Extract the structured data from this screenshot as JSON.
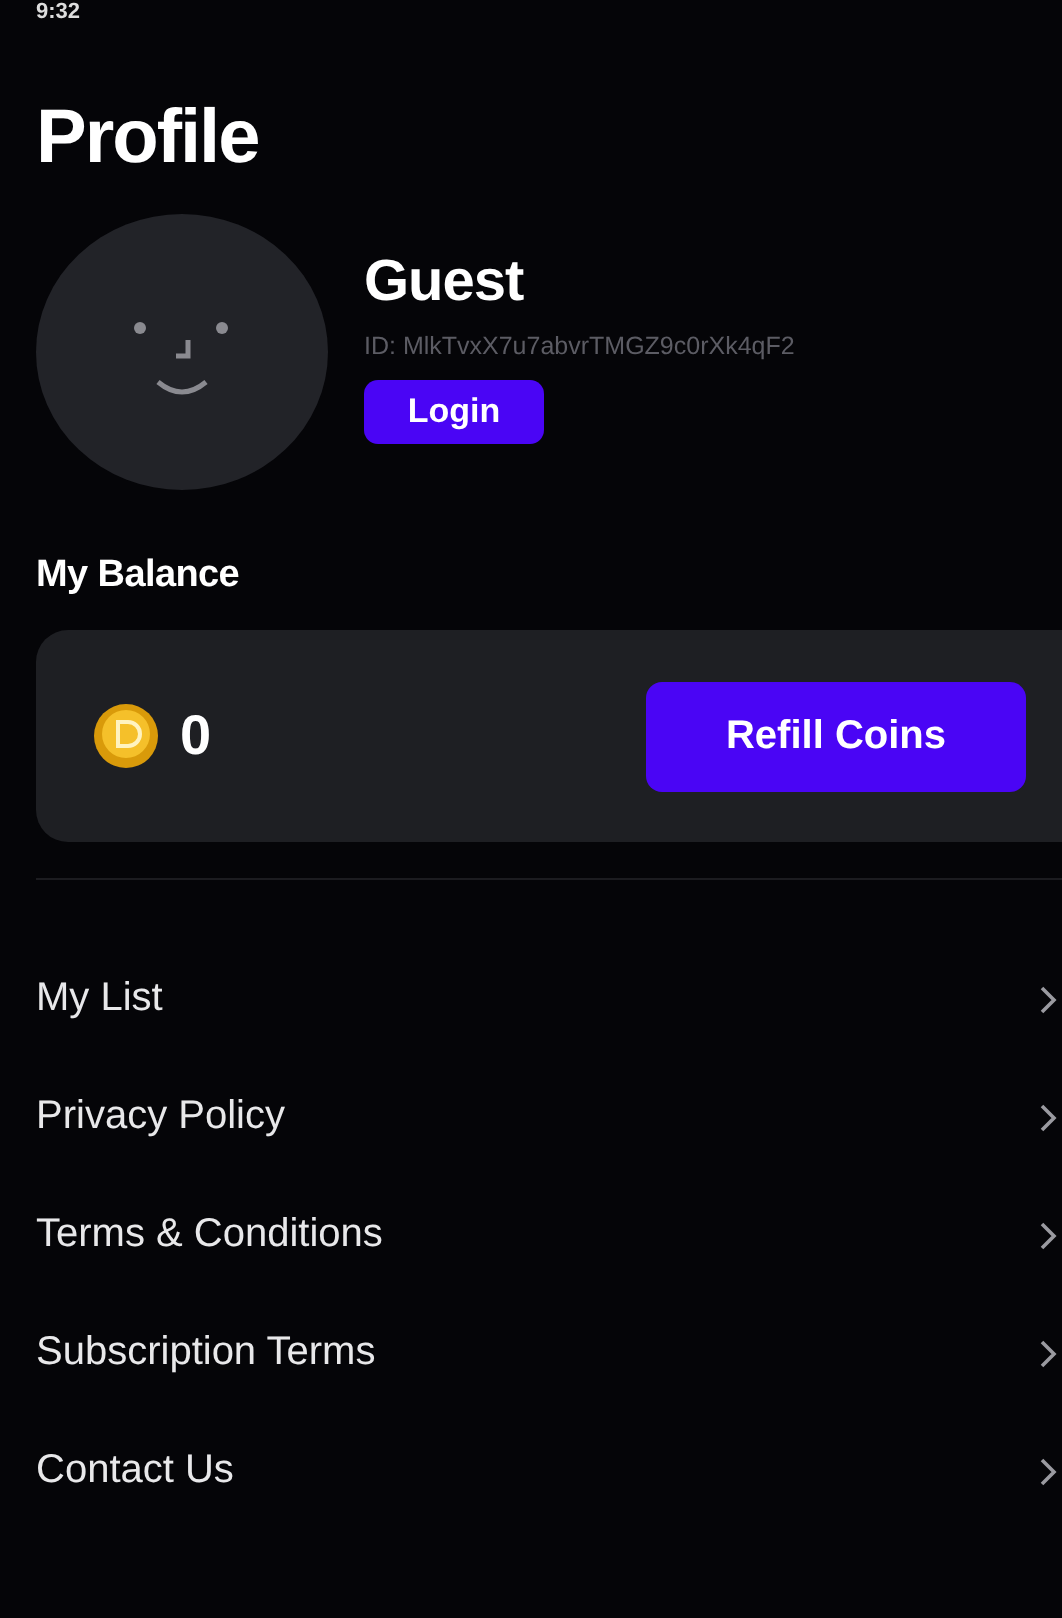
{
  "status_bar": {
    "time": "9:32"
  },
  "title": "Profile",
  "user": {
    "name": "Guest",
    "id": "ID: MlkTvxX7u7abvrTMGZ9c0rXk4qF2",
    "login_button": "Login"
  },
  "balance": {
    "heading": "My Balance",
    "coins": "0",
    "refill_button": "Refill Coins"
  },
  "menu": [
    {
      "label": "My List"
    },
    {
      "label": "Privacy Policy"
    },
    {
      "label": "Terms & Conditions"
    },
    {
      "label": "Subscription Terms"
    },
    {
      "label": "Contact Us"
    }
  ]
}
